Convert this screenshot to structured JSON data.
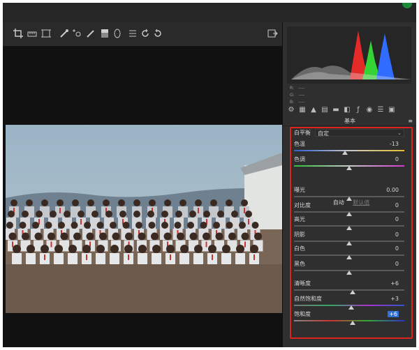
{
  "panel": {
    "section_title": "基本",
    "rgb_readout": [
      {
        "label": "R:",
        "value": "----"
      },
      {
        "label": "G:",
        "value": "----"
      },
      {
        "label": "B:",
        "value": "----"
      }
    ],
    "white_balance": {
      "label": "白平衡",
      "value": "自定"
    },
    "auto_row": {
      "auto_label": "自动",
      "default_label": "默认值"
    },
    "sliders": [
      {
        "key": "temperature",
        "label": "色温",
        "value": "-13",
        "level": 0.46,
        "track": "temp"
      },
      {
        "key": "tint",
        "label": "色调",
        "value": "0",
        "level": 0.5,
        "track": "tint"
      },
      {
        "key": "exposure",
        "label": "曝光",
        "value": "0.00",
        "level": 0.5,
        "track": "gray"
      },
      {
        "key": "contrast",
        "label": "对比度",
        "value": "0",
        "level": 0.5,
        "track": "gray"
      },
      {
        "key": "highlights",
        "label": "高光",
        "value": "0",
        "level": 0.5,
        "track": "gray"
      },
      {
        "key": "shadows",
        "label": "阴影",
        "value": "0",
        "level": 0.5,
        "track": "gray"
      },
      {
        "key": "whites",
        "label": "白色",
        "value": "0",
        "level": 0.5,
        "track": "gray"
      },
      {
        "key": "blacks",
        "label": "黑色",
        "value": "0",
        "level": 0.5,
        "track": "gray"
      },
      {
        "key": "clarity",
        "label": "清晰度",
        "value": "+6",
        "level": 0.53,
        "track": "gray"
      },
      {
        "key": "vibrance",
        "label": "自然饱和度",
        "value": "+3",
        "level": 0.52,
        "track": "vibrance"
      },
      {
        "key": "saturation",
        "label": "饱和度",
        "value": "+6",
        "level": 0.53,
        "track": "saturation"
      }
    ]
  },
  "toolbar_icons": [
    "crop-icon",
    "straighten-icon",
    "transform-icon",
    "spot-removal-icon",
    "red-eye-icon",
    "adjustment-brush-icon",
    "graduated-filter-icon",
    "radial-filter-icon",
    "preferences-icon",
    "rotate-ccw-icon",
    "rotate-cw-icon",
    "fullscreen-toggle-icon"
  ],
  "tab_icons": [
    "basic-tab-icon",
    "tone-curve-tab-icon",
    "detail-tab-icon",
    "hsl-tab-icon",
    "split-toning-tab-icon",
    "lens-tab-icon",
    "effects-tab-icon",
    "camera-calibration-tab-icon",
    "presets-tab-icon",
    "snapshots-tab-icon"
  ],
  "colors": {
    "panel_bg": "#2f2f2f",
    "highlight_border": "#e0221e",
    "selection": "#2f6fd8"
  }
}
